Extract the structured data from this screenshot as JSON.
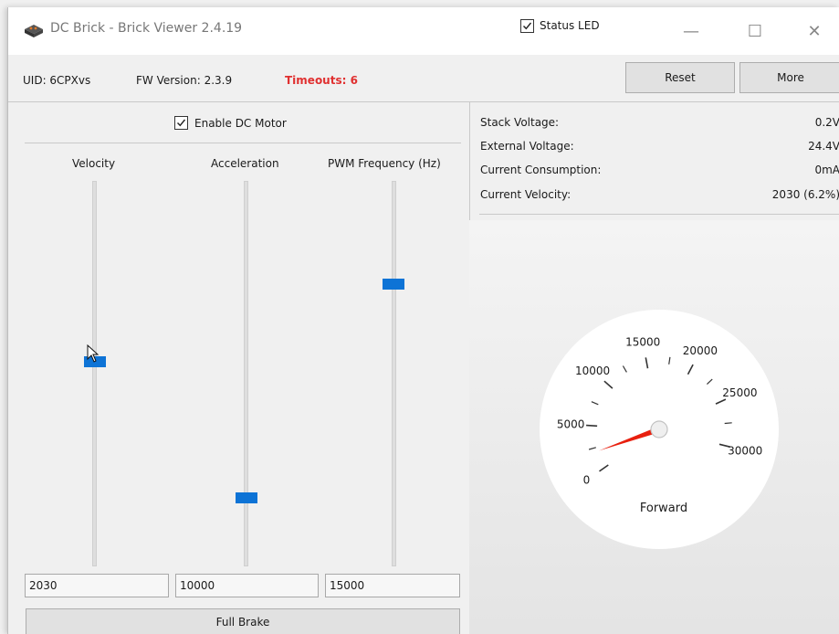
{
  "window": {
    "title": "DC Brick - Brick Viewer 2.4.19",
    "controls": {
      "minimize": "—",
      "maximize": "☐",
      "close": "✕"
    }
  },
  "info": {
    "uid": "UID:  6CPXvs",
    "fw_version": "FW Version:  2.3.9",
    "timeouts": "Timeouts:  6"
  },
  "status_led": {
    "label": "Status LED",
    "checked": true
  },
  "buttons": {
    "reset": "Reset",
    "more": "More",
    "full_brake": "Full Brake"
  },
  "motor": {
    "enable_label": "Enable DC Motor",
    "enabled": true
  },
  "sliders": [
    {
      "name": "velocity",
      "label": "Velocity",
      "value": "2030",
      "fraction": 0.531
    },
    {
      "name": "acceleration",
      "label": "Acceleration",
      "value": "10000",
      "fraction": 0.168
    },
    {
      "name": "pwm-frequency",
      "label": "PWM Frequency (Hz)",
      "value": "15000",
      "fraction": 0.74
    }
  ],
  "stats": [
    {
      "label": "Stack Voltage:",
      "value": "0.2V"
    },
    {
      "label": "External Voltage:",
      "value": "24.4V"
    },
    {
      "label": "Current Consumption:",
      "value": "0mA"
    },
    {
      "label": "Current Velocity:",
      "value": "2030 (6.2%)"
    }
  ],
  "gauge": {
    "direction": "Forward",
    "ticks": [
      "0",
      "5000",
      "10000",
      "15000",
      "20000",
      "25000",
      "30000"
    ],
    "max": 32767,
    "value": 2030,
    "needle_color": "#e8200f"
  },
  "colors": {
    "accent": "#0d73d6",
    "timeouts": "#e03030"
  }
}
